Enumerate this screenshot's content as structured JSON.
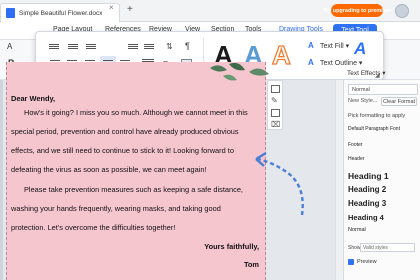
{
  "titlebar": {
    "doc_name": "Simple Beautiful Flower.docx",
    "upgrade_label": "Try upgrading to premium"
  },
  "menu": {
    "page_layout": "Page Layout",
    "references": "References",
    "review": "Review",
    "view": "View",
    "section": "Section",
    "tools": "Tools",
    "drawing_tools": "Drawing Tools",
    "text_tool": "Text Tool"
  },
  "ribbon": {
    "text_fill": "Text Fill",
    "text_outline": "Text Outline",
    "text_effects": "Text Effects",
    "style_glyph": "A",
    "text_fill_glyph": "A",
    "text_outline_glyph": "A",
    "text_effects_glyph": "A"
  },
  "letter": {
    "greeting": "Dear Wendy,",
    "p1": [
      "How's it going? I miss you so much. Although we cannot meet in this",
      "special period, prevention and control have already produced obvious",
      "effects, and we still need to continue to stick to it! Looking forward to",
      "defeating the virus as soon as possible, we can meet again!"
    ],
    "p2": [
      "Please take prevention measures such as keeping a safe distance,",
      "washing your hands frequently, wearing masks, and taking good",
      "protection. Let's overcome the difficulties together!"
    ],
    "closing": "Yours faithfully,",
    "signature": "Tom"
  },
  "styles_pane": {
    "current": "Normal",
    "new_style": "New Style...",
    "clear_format": "Clear Format",
    "pick_label": "Pick formatting to apply",
    "items": [
      "Default Paragraph Font",
      "Footer",
      "Header",
      "Heading 1",
      "Heading 2",
      "Heading 3",
      "Heading 4",
      "Normal"
    ],
    "show_label": "Show:",
    "show_value": "Valid styles",
    "preview": "Preview"
  },
  "colors": {
    "accent": "#2e72f5",
    "page_background": "#f6c6cf",
    "upgrade": "#ff6a00"
  }
}
